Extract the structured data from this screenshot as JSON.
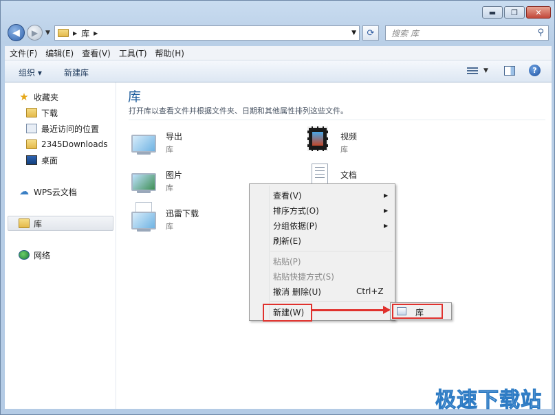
{
  "window": {
    "controls": {
      "minimize": "▬",
      "maximize": "❐",
      "close": "✕"
    }
  },
  "navigation": {
    "back_icon": "◀",
    "forward_icon": "▶",
    "address": {
      "crumb": "库"
    },
    "search_placeholder": "搜索 库"
  },
  "menubar": [
    "文件(F)",
    "编辑(E)",
    "查看(V)",
    "工具(T)",
    "帮助(H)"
  ],
  "commandbar": {
    "organize": "组织 ▾",
    "new_library": "新建库",
    "help": "?"
  },
  "sidebar": {
    "favorites": "收藏夹",
    "downloads": "下载",
    "recent": "最近访问的位置",
    "folder_2345": "2345Downloads",
    "desktop": "桌面",
    "wps": "WPS云文档",
    "libraries": "库",
    "network": "网络"
  },
  "content": {
    "title": "库",
    "description": "打开库以查看文件并根据文件夹、日期和其他属性排列这些文件。",
    "libraries": [
      {
        "name": "导出",
        "sub": "库"
      },
      {
        "name": "视频",
        "sub": "库"
      },
      {
        "name": "图片",
        "sub": "库"
      },
      {
        "name": "文档",
        "sub": "库"
      },
      {
        "name": "迅雷下载",
        "sub": "库"
      }
    ]
  },
  "context_menu": {
    "view": "查看(V)",
    "sort": "排序方式(O)",
    "group": "分组依据(P)",
    "refresh": "刷新(E)",
    "paste": "粘贴(P)",
    "paste_shortcut": "粘贴快捷方式(S)",
    "undo": "撤消 删除(U)",
    "undo_shortcut": "Ctrl+Z",
    "new": "新建(W)"
  },
  "submenu": {
    "library": "库"
  },
  "watermark": "极速下载站",
  "colors": {
    "annotation": "#e0312d",
    "title": "#1e5d9c"
  }
}
